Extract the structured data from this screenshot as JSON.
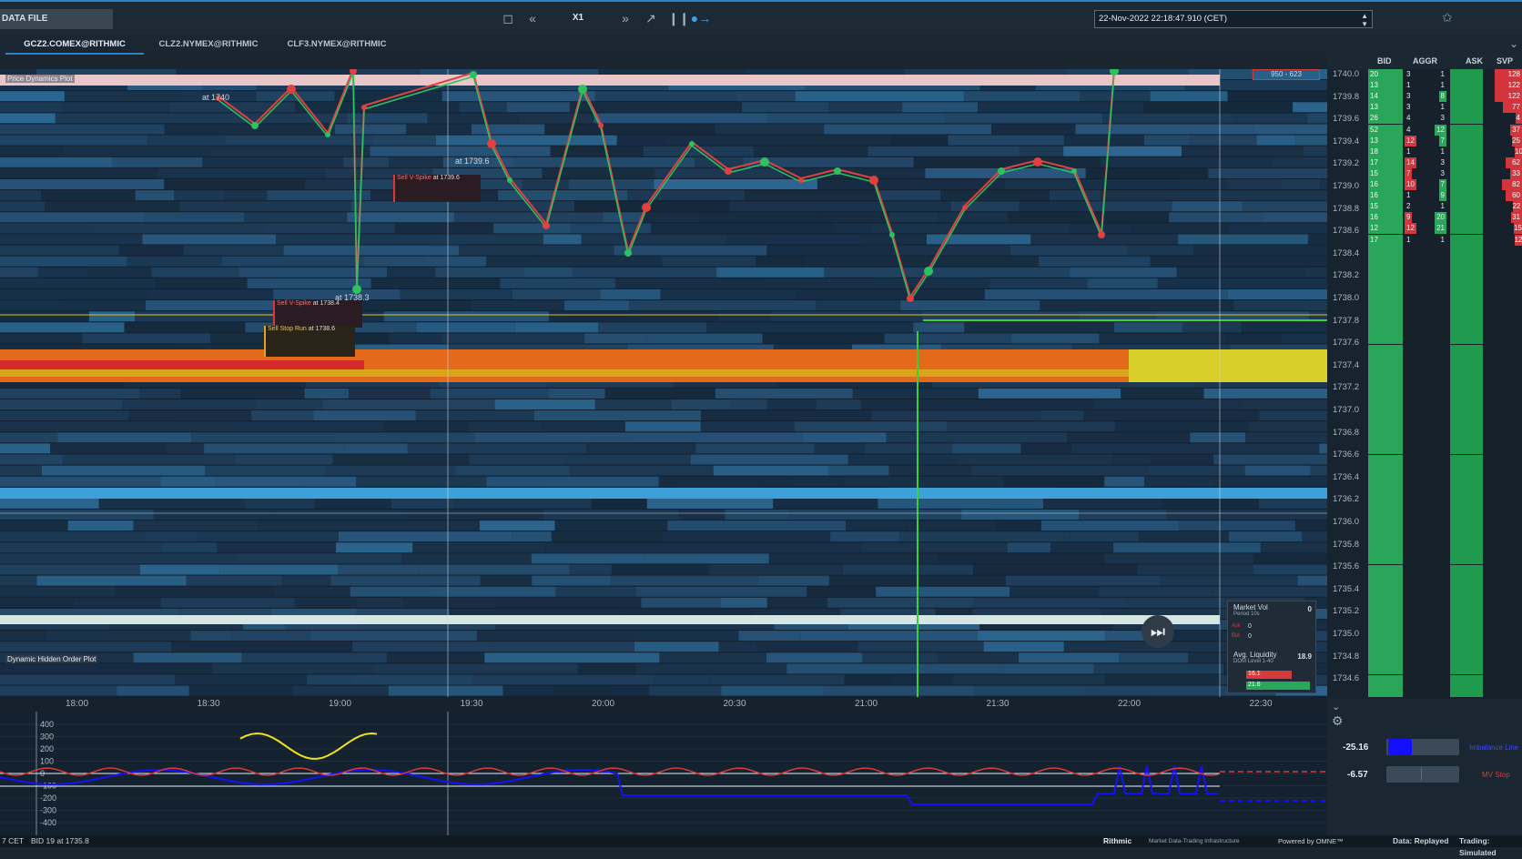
{
  "toolbar": {
    "data_file_label": "DATA FILE",
    "speed_label": "X1",
    "datetime_value": "22-Nov-2022 22:18:47.910 (CET)"
  },
  "tabs": [
    {
      "label": "GCZ2.COMEX@RITHMIC",
      "active": true
    },
    {
      "label": "CLZ2.NYMEX@RITHMIC",
      "active": false
    },
    {
      "label": "CLF3.NYMEX@RITHMIC",
      "active": false
    }
  ],
  "ladder": {
    "headers": {
      "bid": "BID",
      "aggr": "AGGR",
      "ask": "ASK",
      "svp": "SVP"
    },
    "rows": [
      {
        "price": "1740.0",
        "bid": "20",
        "aggr_bid": "3",
        "aggr_ask": "1",
        "svp": "128"
      },
      {
        "price": "1739.8",
        "bid": "13",
        "aggr_bid": "1",
        "aggr_ask": "1",
        "svp": "122"
      },
      {
        "price": "1739.6",
        "bid": "14",
        "aggr_bid": "3",
        "aggr_ask": "8",
        "svp": "122"
      },
      {
        "price": "1739.4",
        "bid": "13",
        "aggr_bid": "3",
        "aggr_ask": "1",
        "svp": "77"
      },
      {
        "price": "1739.2",
        "bid": "26",
        "aggr_bid": "4",
        "aggr_ask": "3",
        "svp": "4"
      },
      {
        "price": "1739.0",
        "bid": "52",
        "aggr_bid": "4",
        "aggr_ask": "12",
        "svp": "37"
      },
      {
        "price": "1738.8",
        "bid": "13",
        "aggr_bid": "12",
        "aggr_ask": "7",
        "svp": "25"
      },
      {
        "price": "1738.6",
        "bid": "18",
        "aggr_bid": "1",
        "aggr_ask": "1",
        "svp": "10"
      },
      {
        "price": "1738.4",
        "bid": "17",
        "aggr_bid": "14",
        "aggr_ask": "3",
        "svp": "62"
      },
      {
        "price": "1738.2",
        "bid": "15",
        "aggr_bid": "7",
        "aggr_ask": "3",
        "svp": "33"
      },
      {
        "price": "1738.0",
        "bid": "16",
        "aggr_bid": "10",
        "aggr_ask": "7",
        "svp": "82"
      },
      {
        "price": "1737.8",
        "bid": "16",
        "aggr_bid": "1",
        "aggr_ask": "9",
        "svp": "60"
      },
      {
        "price": "1737.6",
        "bid": "15",
        "aggr_bid": "2",
        "aggr_ask": "1",
        "svp": "22"
      },
      {
        "price": "1737.4",
        "bid": "16",
        "aggr_bid": "9",
        "aggr_ask": "20",
        "svp": "31"
      },
      {
        "price": "1737.2",
        "bid": "12",
        "aggr_bid": "12",
        "aggr_ask": "21",
        "svp": "15"
      },
      {
        "price": "1737.0",
        "bid": "17",
        "aggr_bid": "1",
        "aggr_ask": "1",
        "svp": "12"
      }
    ]
  },
  "price_scale": [
    "1740.0",
    "1739.8",
    "1739.6",
    "1739.4",
    "1739.2",
    "1739.0",
    "1738.8",
    "1738.6",
    "1738.4",
    "1738.2",
    "1738.0",
    "1737.8",
    "1737.6",
    "1737.4",
    "1737.2",
    "1737.0",
    "1736.8",
    "1736.6",
    "1736.4",
    "1736.2",
    "1736.0",
    "1735.8",
    "1735.6",
    "1735.4",
    "1735.2",
    "1735.0",
    "1734.8",
    "1734.6"
  ],
  "time_axis": [
    "18:00",
    "18:30",
    "19:00",
    "19:30",
    "20:00",
    "20:30",
    "21:00",
    "21:30",
    "22:00",
    "22:30"
  ],
  "indicator_scale": [
    "400",
    "300",
    "200",
    "100",
    "0",
    "-100",
    "-200",
    "-300",
    "-400"
  ],
  "overlays": {
    "price_dynamics_plot": "Price Dynamics Plot",
    "hidden_order_plot": "Dynamic Hidden Order Plot",
    "sell_v_spike_1": "Sell V-Spike",
    "sell_v_spike_1_at": "at 1739.6",
    "sell_v_spike_2": "Sell V-Spike",
    "sell_v_spike_2_at": "at 1738.4",
    "sell_stop_run": "Sell Stop Run",
    "sell_stop_run_at": "at 1738.6",
    "at_1740": "at 1740",
    "at_1739_6": "at 1739.6",
    "at_1738_3": "at 1738.3",
    "range_box": "950 - 623"
  },
  "market_vol": {
    "title": "Market Vol",
    "period": "Period 10s",
    "value": "0",
    "ask_label": "Ask",
    "ask_value": "0",
    "bid_label": "Bid",
    "bid_value": "0",
    "avg_liquidity_title": "Avg. Liquidity",
    "avg_liquidity_sub": "DOM Level 1-40",
    "avg_liquidity_value": "18.9",
    "avg_ask": "16.1",
    "avg_bid": "21.6"
  },
  "side_panel": {
    "imbalance_value": "-25.16",
    "imbalance_label": "Imbalance Line",
    "mv_value": "-6.57",
    "mv_label": "MV Stop"
  },
  "status": {
    "left": "7 CET",
    "bid_info": "BID 19 at 1735.8",
    "rithmic": "Rithmic",
    "rithmic_sub": "Market Data-Trading Infrastructure",
    "powered": "Powered by OMNE™",
    "data_mode": "Data: Replayed",
    "trading_mode": "Trading: Simulated"
  },
  "colors": {
    "accent": "#2b83c6",
    "bid_green": "#2aa65a",
    "ask_red": "#d2353b",
    "price_line_green": "#3ad03a",
    "heat_orange": "#e36a1a",
    "heat_yellow": "#d8cf2a"
  }
}
